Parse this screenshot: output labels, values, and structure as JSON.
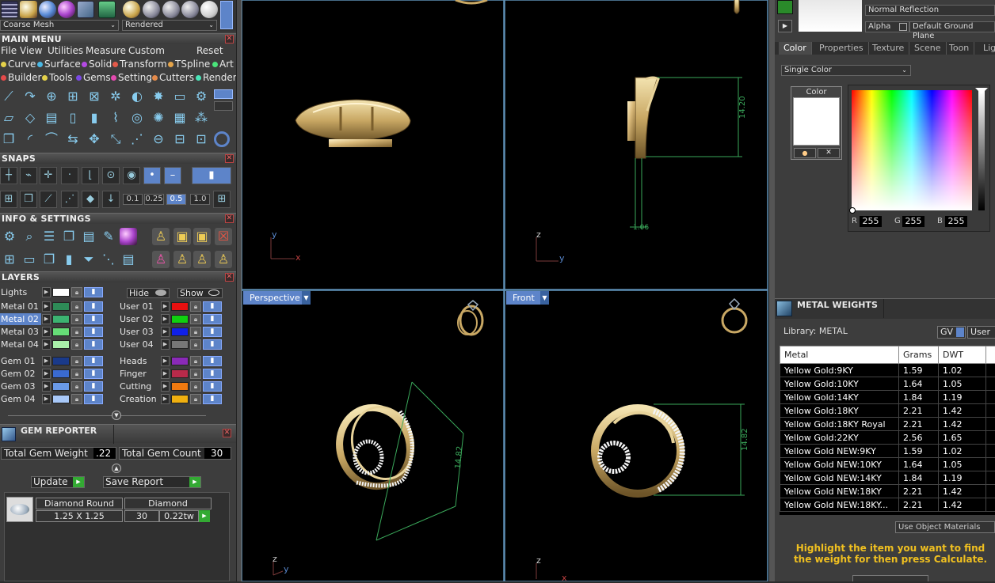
{
  "toolbar_top": {
    "mesh_mode": "Coarse Mesh",
    "render_mode": "Rendered"
  },
  "main_menu": {
    "title": "MAIN MENU",
    "menubar": [
      "File",
      "View",
      "Utilities",
      "Measure",
      "Custom",
      "Reset"
    ],
    "row1": [
      {
        "label": "Curve",
        "color": "#e4d14a"
      },
      {
        "label": "Surface",
        "color": "#4ab8e4"
      },
      {
        "label": "Solid",
        "color": "#b44ae4"
      },
      {
        "label": "Transform",
        "color": "#e45a4a"
      },
      {
        "label": "TSpline",
        "color": "#e4a44a"
      },
      {
        "label": "Art",
        "color": "#4ae47a"
      }
    ],
    "row2": [
      {
        "label": "Builder",
        "color": "#e44a4a"
      },
      {
        "label": "Tools",
        "color": "#e4d14a"
      },
      {
        "label": "Gems",
        "color": "#7a4ae4"
      },
      {
        "label": "Setting",
        "color": "#e44ab0"
      },
      {
        "label": "Cutters",
        "color": "#e48a4a"
      },
      {
        "label": "Render",
        "color": "#4ae4b8"
      }
    ]
  },
  "snaps": {
    "title": "SNAPS",
    "values": [
      "0.1",
      "0.25",
      "0.5",
      "1.0"
    ],
    "active_value": "0.5"
  },
  "info_settings": {
    "title": "INFO & SETTINGS"
  },
  "layers": {
    "title": "LAYERS",
    "lights_label": "Lights",
    "hide_label": "Hide",
    "show_label": "Show",
    "left": [
      {
        "name": "Metal 01",
        "color": "#2e8b57",
        "selected": false
      },
      {
        "name": "Metal 02",
        "color": "#3cb371",
        "selected": true
      },
      {
        "name": "Metal 03",
        "color": "#66dd77",
        "selected": false
      },
      {
        "name": "Metal 04",
        "color": "#aaf0aa",
        "selected": false
      },
      {
        "name": "Gem 01",
        "color": "#1a3a8a",
        "selected": false
      },
      {
        "name": "Gem 02",
        "color": "#3a6ad0",
        "selected": false
      },
      {
        "name": "Gem 03",
        "color": "#6a9ae8",
        "selected": false
      },
      {
        "name": "Gem 04",
        "color": "#a8c8f8",
        "selected": false
      }
    ],
    "right": [
      {
        "name": "User 01",
        "color": "#e81010"
      },
      {
        "name": "User 02",
        "color": "#10d010"
      },
      {
        "name": "User 03",
        "color": "#1020e8"
      },
      {
        "name": "User 04",
        "color": "#777777"
      },
      {
        "name": "Heads",
        "color": "#8a2ab8"
      },
      {
        "name": "Finger",
        "color": "#b82a4a"
      },
      {
        "name": "Cutting",
        "color": "#f07a10"
      },
      {
        "name": "Creation",
        "color": "#f0b010"
      }
    ]
  },
  "gem_reporter": {
    "title": "GEM REPORTER",
    "total_weight_label": "Total Gem Weight",
    "total_weight": ".22",
    "total_count_label": "Total Gem Count",
    "total_count": "30",
    "update_label": "Update",
    "save_label": "Save Report",
    "row": {
      "shape": "Diamond Round",
      "size": "1.25 X 1.25",
      "material": "Diamond",
      "count": "30",
      "weight": "0.22tw"
    }
  },
  "viewports": {
    "perspective_label": "Perspective",
    "front_label": "Front",
    "dim_side": "14.20",
    "dim_side_small": "1.06",
    "dim_persp": "14.82",
    "dim_front": "14.82"
  },
  "right_panel": {
    "reflection": "Normal Reflection",
    "alpha": "Alpha",
    "ground": "Default Ground Plane",
    "tabs": [
      "Color",
      "Properties",
      "Texture",
      "Scene",
      "Toon",
      "Lig"
    ],
    "color_mode": "Single Color",
    "color_label": "Color",
    "r": "255",
    "g": "255",
    "b": "255"
  },
  "metal_weights": {
    "title": "METAL WEIGHTS",
    "library": "Library: METAL",
    "gv": "GV",
    "user": "User",
    "columns": [
      "Metal",
      "Grams",
      "DWT"
    ],
    "rows": [
      [
        "Yellow Gold:9KY",
        "1.59",
        "1.02"
      ],
      [
        "Yellow Gold:10KY",
        "1.64",
        "1.05"
      ],
      [
        "Yellow Gold:14KY",
        "1.84",
        "1.19"
      ],
      [
        "Yellow Gold:18KY",
        "2.21",
        "1.42"
      ],
      [
        "Yellow Gold:18KY Royal",
        "2.21",
        "1.42"
      ],
      [
        "Yellow Gold:22KY",
        "2.56",
        "1.65"
      ],
      [
        "Yellow Gold NEW:9KY",
        "1.59",
        "1.02"
      ],
      [
        "Yellow Gold NEW:10KY",
        "1.64",
        "1.05"
      ],
      [
        "Yellow Gold NEW:14KY",
        "1.84",
        "1.19"
      ],
      [
        "Yellow Gold NEW:18KY",
        "2.21",
        "1.42"
      ],
      [
        "Yellow Gold NEW:18KY...",
        "2.21",
        "1.42"
      ]
    ],
    "use_object_materials": "Use Object Materials",
    "hint": "Highlight the item you want to find the weight for then press Calculate."
  }
}
